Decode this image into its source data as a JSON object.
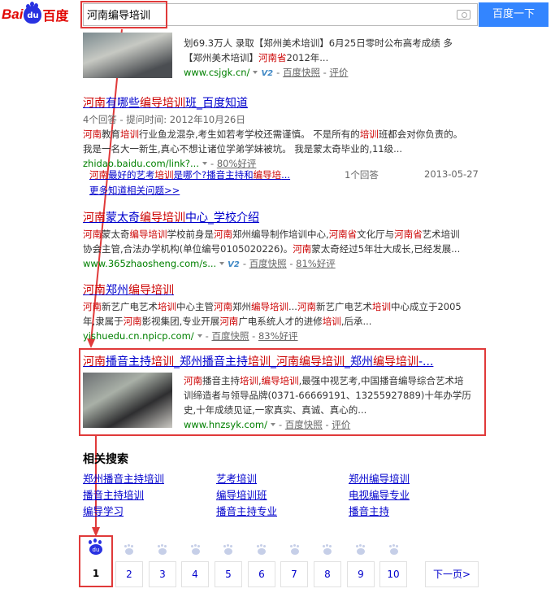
{
  "header": {
    "logo_bai": "Bai",
    "logo_du": "du",
    "logo_cn": "百度",
    "query": "河南编导培训",
    "search_button": "百度一下"
  },
  "results": {
    "r0": {
      "abs1": "划69.3万人 录取【郑州美术培训】6月25日零时公布高考成绩 多",
      "abs2a": "【郑州美术培训】",
      "abs2b": "河南省",
      "abs2c": "2012年...",
      "url": "www.csjgk.cn/",
      "v": "V2",
      "snapshot": "百度快照",
      "review": "评价"
    },
    "r1": {
      "title_a": "河南",
      "title_b": "有哪些",
      "title_c": "编导培训",
      "title_d": "班_百度知道",
      "meta": "4个回答 - 提问时间: 2012年10月26日",
      "abs1_a": "河南",
      "abs1_b": "教育",
      "abs1_c": "培训",
      "abs1_d": "行业鱼龙混杂,考生如若考学校还需谨慎。 不是所有的",
      "abs1_e": "培训",
      "abs1_f": "班都会对你负责的。",
      "abs2": "我是一名大一新生,真心不想让诸位学弟学妹被坑。 我是蒙太奇毕业的,11级...",
      "url": "zhidao.baidu.com/link?...",
      "good": "80%好评",
      "q_a": "河南",
      "q_b": "最好的艺考",
      "q_c": "培训",
      "q_d": "是哪个?播音主持和",
      "q_e": "编导培",
      "q_f": "...",
      "answers": "1个回答",
      "date": "2013-05-27",
      "more": "更多知道相关问题>>"
    },
    "r2": {
      "title_a": "河南",
      "title_b": "蒙太奇",
      "title_c": "编导培训",
      "title_d": "中心_学校介绍",
      "abs1_a": "河南",
      "abs1_b": "蒙太奇",
      "abs1_c": "编导培训",
      "abs1_d": "学校前身是",
      "abs1_e": "河南",
      "abs1_f": "郑州编导制作培训中心,",
      "abs1_g": "河南省",
      "abs1_h": "文化厅与",
      "abs1_i": "河南省",
      "abs1_j": "艺术培训",
      "abs2_a": "协会主管,合法办学机构(单位编号0105020226)。",
      "abs2_b": "河南",
      "abs2_c": "蒙太奇经过5年壮大成长,已经发展...",
      "url": "www.365zhaosheng.com/s...",
      "snapshot": "百度快照",
      "good": "81%好评"
    },
    "r3": {
      "title_a": "河南",
      "title_b": "郑州",
      "title_c": "编导培训",
      "abs1_a": "河南",
      "abs1_b": "新艺广电艺术",
      "abs1_c": "培训",
      "abs1_d": "中心主管",
      "abs1_e": "河南",
      "abs1_f": "郑州",
      "abs1_g": "编导培训",
      "abs1_h": "...",
      "abs1_i": "河南",
      "abs1_j": "新艺广电艺术",
      "abs1_k": "培训",
      "abs1_l": "中心成立于2005",
      "abs2_a": "年,隶属于",
      "abs2_b": "河南",
      "abs2_c": "影视集团,专业开展",
      "abs2_d": "河南",
      "abs2_e": "广电系统人才的进修",
      "abs2_f": "培训",
      "abs2_g": ",后承...",
      "url": "yishuedu.cn.npicp.com/",
      "snapshot": "百度快照",
      "good": "83%好评"
    },
    "r4": {
      "title_a": "河南",
      "title_b": "播音主持",
      "title_c": "培训",
      "title_d": "_郑州播音主持",
      "title_e": "培训",
      "title_f": "_",
      "title_g": "河南",
      "title_h": "编导培训",
      "title_i": "_郑州",
      "title_j": "编导培训",
      "title_k": "-...",
      "abs1_a": "河南",
      "abs1_b": "播音主持",
      "abs1_c": "培训",
      "abs1_d": ",",
      "abs1_e": "编导培训",
      "abs1_f": ",最强中视艺考,中国播音编导综合艺术培",
      "abs2": "训缔造者与领导品牌(0371-66669191、13255927889)十年办学历",
      "abs3": "史,十年成绩见证,一家真实、真诚、真心的...",
      "url": "www.hnzsyk.com/",
      "snapshot": "百度快照",
      "review": "评价"
    }
  },
  "related": {
    "title": "相关搜索",
    "items": [
      "郑州播音主持培训",
      "艺考培训",
      "郑州编导培训",
      "播音主持培训",
      "编导培训班",
      "电视编导专业",
      "编导学习",
      "播音主持专业",
      "播音主持"
    ]
  },
  "pager": {
    "pages": [
      "1",
      "2",
      "3",
      "4",
      "5",
      "6",
      "7",
      "8",
      "9",
      "10"
    ],
    "next": "下一页>",
    "paw_du": "du"
  },
  "colors": {
    "accent": "#3385ff",
    "link": "#0000cc",
    "highlight": "#c00",
    "url_green": "#008000",
    "annotation_red": "#e03a3a"
  }
}
